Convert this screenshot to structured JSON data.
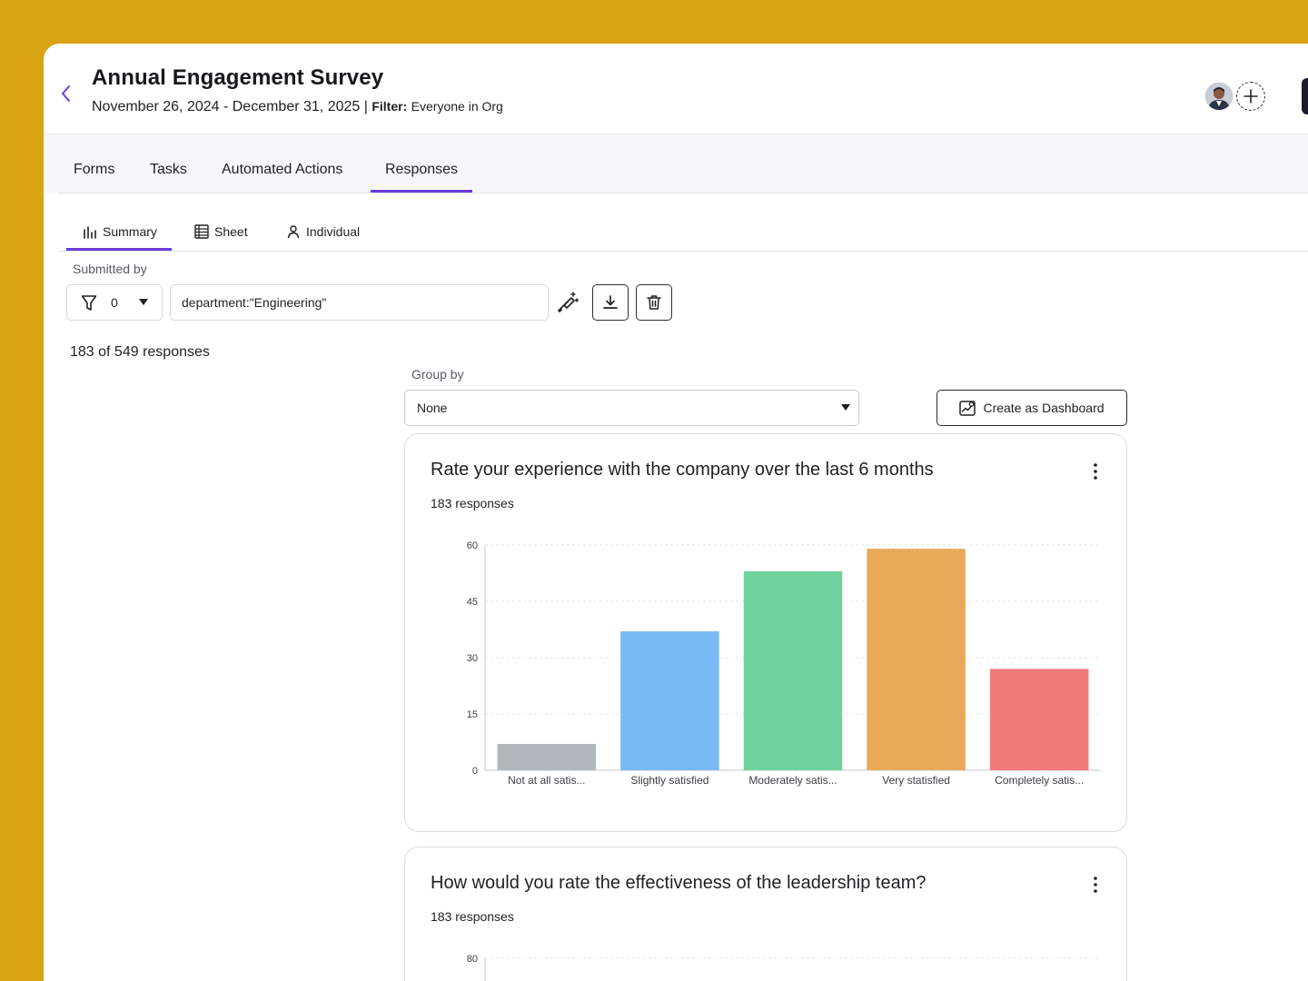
{
  "header": {
    "title": "Annual Engagement Survey",
    "date_range": "November 26, 2024 - December 31, 2025",
    "separator": " | ",
    "filter_label": "Filter:",
    "filter_value": "Everyone in Org"
  },
  "tabs": [
    {
      "label": "Forms",
      "active": false
    },
    {
      "label": "Tasks",
      "active": false
    },
    {
      "label": "Automated Actions",
      "active": false
    },
    {
      "label": "Responses",
      "active": true
    }
  ],
  "subtabs": [
    {
      "label": "Summary",
      "icon": "bar-chart-icon",
      "active": true
    },
    {
      "label": "Sheet",
      "icon": "table-icon",
      "active": false
    },
    {
      "label": "Individual",
      "icon": "person-icon",
      "active": false
    }
  ],
  "filters": {
    "submitted_by_label": "Submitted by",
    "filter_count": "0",
    "query_value": "department:\"Engineering\""
  },
  "response_summary": "183 of 549 responses",
  "group_by": {
    "label": "Group by",
    "selected": "None"
  },
  "create_dashboard_label": "Create as Dashboard",
  "accent_color": "#6b3bdc",
  "chart_data": [
    {
      "type": "bar",
      "title": "Rate your experience with the company over the last 6 months",
      "subtitle": "183 responses",
      "categories": [
        "Not at all satis...",
        "Slightly satisfied",
        "Moderately satis...",
        "Very statisfied",
        "Completely satis..."
      ],
      "values": [
        7,
        37,
        53,
        59,
        27
      ],
      "colors": [
        "#b1b6bd",
        "#78b9f6",
        "#6fd29c",
        "#e8a958",
        "#ef7b79"
      ],
      "yticks": [
        0,
        15,
        30,
        45,
        60
      ],
      "ylim": [
        0,
        60
      ],
      "grid": true,
      "xlabel": "",
      "ylabel": ""
    },
    {
      "type": "bar",
      "title": "How would you rate the effectiveness of the leadership team?",
      "subtitle": "183 responses",
      "categories": [],
      "values": [],
      "yticks": [
        80
      ],
      "ylim": [
        0,
        80
      ],
      "grid": true,
      "xlabel": "",
      "ylabel": ""
    }
  ]
}
